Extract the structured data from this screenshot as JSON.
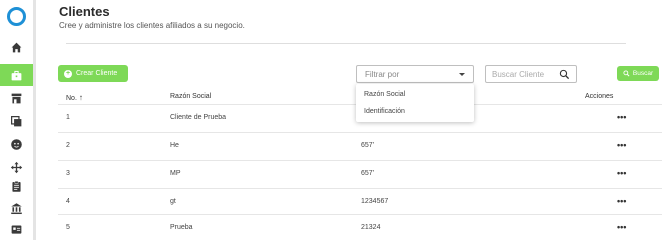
{
  "header": {
    "title": "Clientes",
    "subtitle": "Cree y administre los clientes afiliados a su negocio."
  },
  "sidebar": {
    "items": [
      {
        "name": "home-icon"
      },
      {
        "name": "briefcase-icon",
        "active": true
      },
      {
        "name": "store-icon"
      },
      {
        "name": "copy-icon"
      },
      {
        "name": "face-icon"
      },
      {
        "name": "move-icon"
      },
      {
        "name": "clipboard-icon"
      },
      {
        "name": "bank-icon"
      },
      {
        "name": "id-card-icon"
      }
    ]
  },
  "toolbar": {
    "create_label": "Crear Cliente",
    "filter_placeholder": "Filtrar por",
    "search_placeholder": "Buscar Cliente",
    "search_label": "Buscar"
  },
  "filter_options": [
    "Razón Social",
    "Identificación"
  ],
  "table": {
    "columns": [
      "No.",
      "Razón Social",
      "Acciones"
    ],
    "rows": [
      {
        "no": "1",
        "razon": "Cliente de Prueba",
        "id": ""
      },
      {
        "no": "2",
        "razon": "He",
        "id": "657’"
      },
      {
        "no": "3",
        "razon": "MP",
        "id": "657’"
      },
      {
        "no": "4",
        "razon": "gt",
        "id": "1234567"
      },
      {
        "no": "5",
        "razon": "Prueba",
        "id": "21324"
      }
    ],
    "action_glyph": "•••"
  },
  "colors": {
    "accent": "#7ed957",
    "logo": "#1e90d6"
  }
}
